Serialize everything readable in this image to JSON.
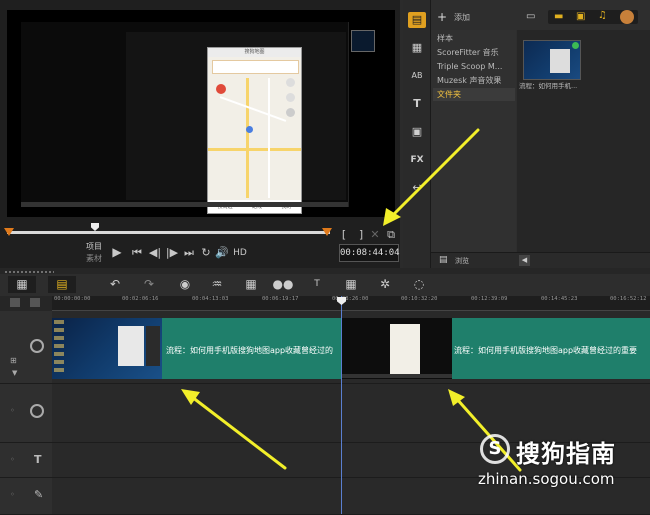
{
  "preview": {
    "timecode": "00:08:44:04",
    "project_label": "项目",
    "clip_label": "素材",
    "hd_label": "HD",
    "bracket_in": "[",
    "bracket_out": "]",
    "phone_top_text": "搜狗地图",
    "phone_btn1": "搜周边",
    "phone_btn2": "路线",
    "phone_btn3": "我的"
  },
  "library": {
    "add_label": "添加",
    "folders": [
      "样本",
      "ScoreFitter 音乐",
      "Triple Scoop M...",
      "Muzesk 声音效果",
      "文件夹"
    ],
    "selected_folder": "文件夹",
    "thumb_caption": "流程：如何用手机...",
    "browse_label": "浏览"
  },
  "timeline": {
    "ruler_ticks": [
      "00:00:00:00",
      "00:02:06:16",
      "00:04:13:03",
      "00:06:19:17",
      "00:08:26:00",
      "00:10:32:20",
      "00:12:39:09",
      "00:14:45:23",
      "00:16:52:12"
    ],
    "clip1_text": "流程：如何用手机版搜狗地图app收藏曾经过的",
    "clip2_text": "流程：如何用手机版搜狗地图app收藏曾经过的重要"
  },
  "watermark": {
    "brand": "搜狗指南",
    "url": "zhinan.sogou.com"
  },
  "colors": {
    "accent_orange": "#e07a1b",
    "clip_green": "#1f7f6b",
    "selected_folder": "#f0c040",
    "arrow_yellow": "#f2ef2a"
  }
}
